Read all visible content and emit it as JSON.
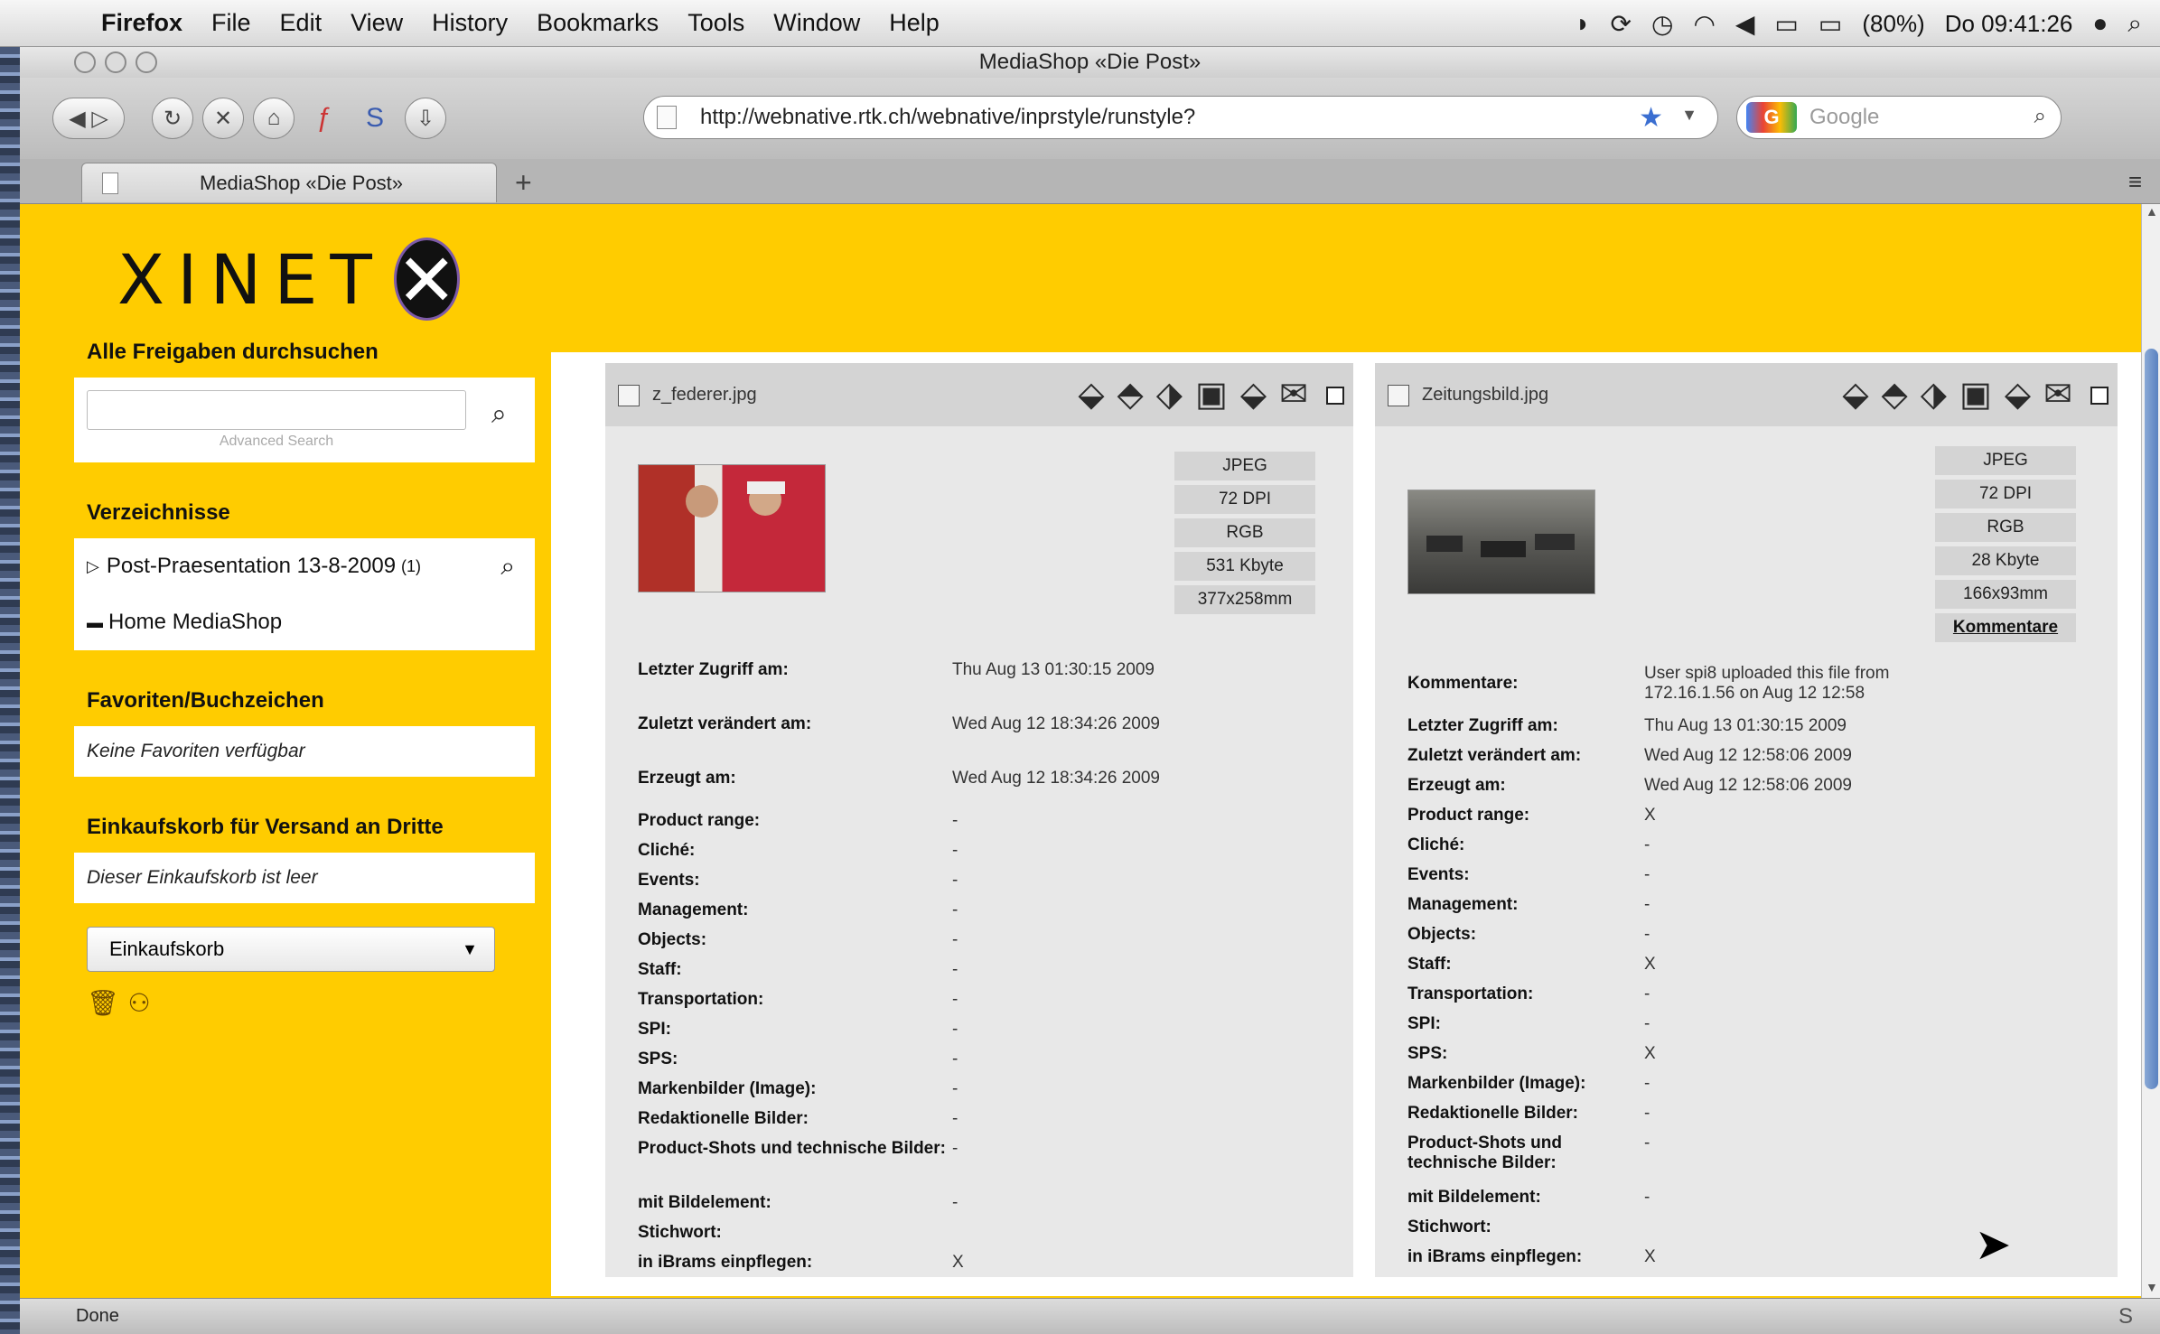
{
  "menubar": {
    "app": "Firefox",
    "items": [
      "File",
      "Edit",
      "View",
      "History",
      "Bookmarks",
      "Tools",
      "Window",
      "Help"
    ],
    "battery": "(80%)",
    "clock": "Do 09:41:26"
  },
  "window": {
    "title": "MediaShop «Die Post»"
  },
  "toolbar": {
    "url": "http://webnative.rtk.ch/webnative/inprstyle/runstyle?",
    "search_placeholder": "Google"
  },
  "tab": {
    "label": "MediaShop «Die Post»"
  },
  "sidebar": {
    "search_title": "Alle Freigaben durchsuchen",
    "advanced": "Advanced Search",
    "dirs_title": "Verzeichnisse",
    "dir1": "Post-Praesentation 13-8-2009",
    "dir1_count": "(1)",
    "dir2": "Home MediaShop",
    "fav_title": "Favoriten/Buchzeichen",
    "fav_empty": "Keine Favoriten verfügbar",
    "cart_title": "Einkaufskorb für Versand an Dritte",
    "cart_empty": "Dieser Einkaufskorb ist leer",
    "cart_select": "Einkaufskorb"
  },
  "cards": [
    {
      "filename": "z_federer.jpg",
      "format": "JPEG",
      "dpi": "72 DPI",
      "color": "RGB",
      "size": "531 Kbyte",
      "dims": "377x258mm",
      "rows": [
        [
          "Letzter Zugriff am:",
          "Thu Aug 13 01:30:15 2009"
        ],
        [
          "Zuletzt verändert am:",
          "Wed Aug 12 18:34:26 2009"
        ],
        [
          "Erzeugt am:",
          "Wed Aug 12 18:34:26 2009"
        ],
        [
          "Product range:",
          "-"
        ],
        [
          "Cliché:",
          "-"
        ],
        [
          "Events:",
          "-"
        ],
        [
          "Management:",
          "-"
        ],
        [
          "Objects:",
          "-"
        ],
        [
          "Staff:",
          "-"
        ],
        [
          "Transportation:",
          "-"
        ],
        [
          "SPI:",
          "-"
        ],
        [
          "SPS:",
          "-"
        ],
        [
          "Markenbilder (Image):",
          "-"
        ],
        [
          "Redaktionelle Bilder:",
          "-"
        ],
        [
          "Product-Shots und technische Bilder:",
          "-"
        ],
        [
          "mit Bildelement:",
          "-"
        ],
        [
          "Stichwort:",
          ""
        ],
        [
          "in iBrams einpflegen:",
          "X"
        ]
      ]
    },
    {
      "filename": "Zeitungsbild.jpg",
      "format": "JPEG",
      "dpi": "72 DPI",
      "color": "RGB",
      "size": "28 Kbyte",
      "dims": "166x93mm",
      "comments_link": "Kommentare",
      "rows": [
        [
          "Kommentare:",
          "User spi8 uploaded this file from 172.16.1.56 on Aug 12 12:58"
        ],
        [
          "Letzter Zugriff am:",
          "Thu Aug 13 01:30:15 2009"
        ],
        [
          "Zuletzt verändert am:",
          "Wed Aug 12 12:58:06 2009"
        ],
        [
          "Erzeugt am:",
          "Wed Aug 12 12:58:06 2009"
        ],
        [
          "Product range:",
          "X"
        ],
        [
          "Cliché:",
          "-"
        ],
        [
          "Events:",
          "-"
        ],
        [
          "Management:",
          "-"
        ],
        [
          "Objects:",
          "-"
        ],
        [
          "Staff:",
          "X"
        ],
        [
          "Transportation:",
          "-"
        ],
        [
          "SPI:",
          "-"
        ],
        [
          "SPS:",
          "X"
        ],
        [
          "Markenbilder (Image):",
          "-"
        ],
        [
          "Redaktionelle Bilder:",
          "-"
        ],
        [
          "Product-Shots und technische Bilder:",
          "-"
        ],
        [
          "mit Bildelement:",
          "-"
        ],
        [
          "Stichwort:",
          ""
        ],
        [
          "in iBrams einpflegen:",
          "X"
        ]
      ]
    }
  ],
  "status": {
    "text": "Done"
  },
  "colors": {
    "brand_yellow": "#ffcc00",
    "panel_gray": "#e8e8e8"
  }
}
